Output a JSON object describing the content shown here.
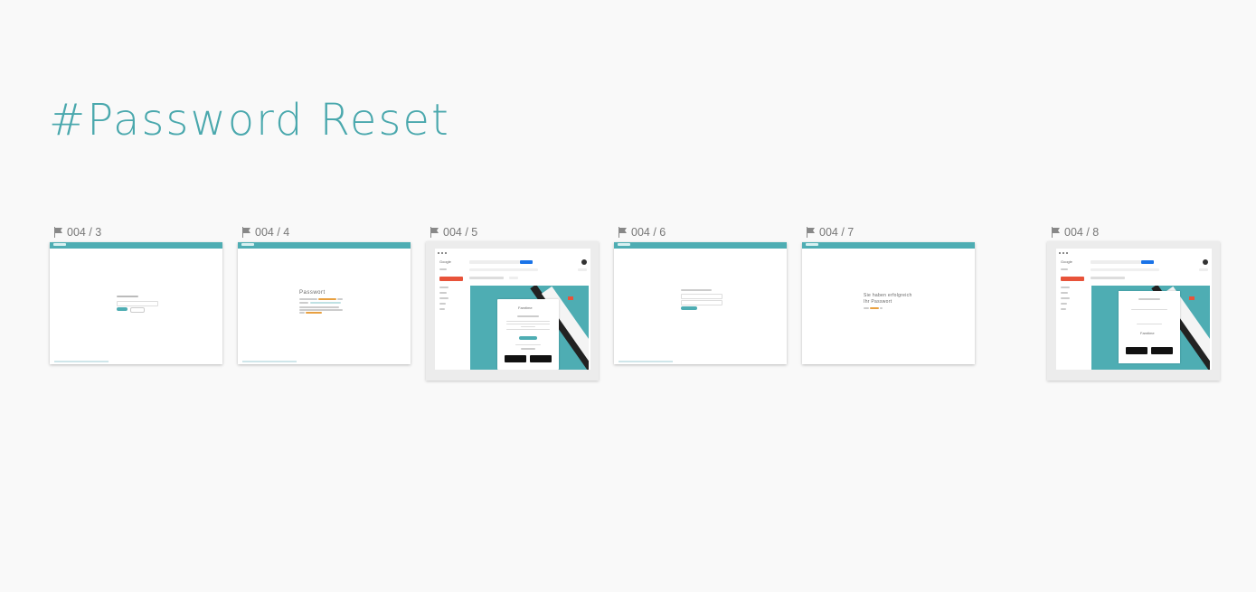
{
  "page": {
    "title": "#Password Reset"
  },
  "screens": [
    {
      "label": "004 / 3",
      "icon": "flag-icon"
    },
    {
      "label": "004 / 4",
      "icon": "flag-icon",
      "heading": "Passwort"
    },
    {
      "label": "004 / 5",
      "icon": "flag-icon",
      "mail_logo": "Google",
      "popup_brand": "Famtime"
    },
    {
      "label": "004 / 6",
      "icon": "flag-icon"
    },
    {
      "label": "004 / 7",
      "icon": "flag-icon",
      "message_line1": "Sie haben erfolgreich",
      "message_line2": "Ihr Passwort"
    },
    {
      "label": "004 / 8",
      "icon": "flag-icon",
      "mail_logo": "Google",
      "popup_brand": "Famtime"
    }
  ],
  "colors": {
    "accent": "#4eadb3",
    "title": "#4aa8ad",
    "orange": "#e8a040",
    "red": "#e8533a",
    "blue": "#1a73e8"
  }
}
